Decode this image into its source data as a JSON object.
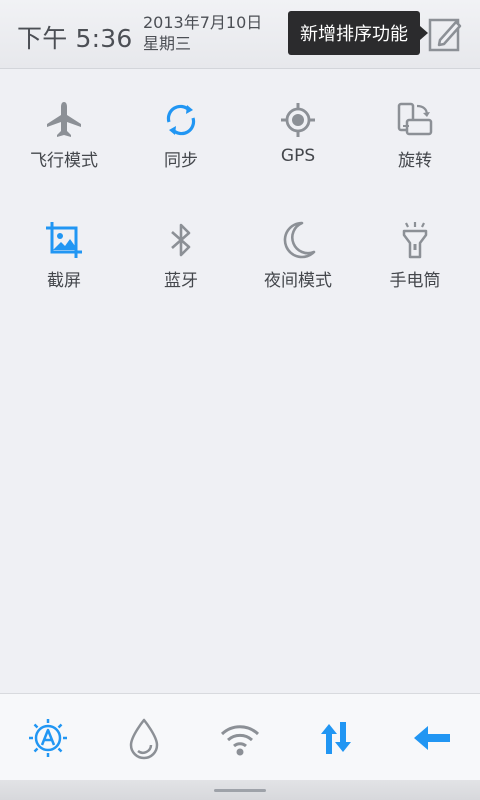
{
  "status": {
    "time": "下午 5:36",
    "date": "2013年7月10日",
    "weekday": "星期三"
  },
  "tooltip": {
    "text": "新增排序功能"
  },
  "toggles": [
    {
      "label": "飞行模式",
      "icon": "airplane-icon",
      "color": "#8c9096"
    },
    {
      "label": "同步",
      "icon": "sync-icon",
      "color": "#2196f3"
    },
    {
      "label": "GPS",
      "icon": "gps-icon",
      "color": "#8c9096"
    },
    {
      "label": "旋转",
      "icon": "rotate-icon",
      "color": "#8c9096"
    },
    {
      "label": "截屏",
      "icon": "screenshot-icon",
      "color": "#2196f3"
    },
    {
      "label": "蓝牙",
      "icon": "bluetooth-icon",
      "color": "#8c9096"
    },
    {
      "label": "夜间模式",
      "icon": "night-mode-icon",
      "color": "#8c9096"
    },
    {
      "label": "手电筒",
      "icon": "flashlight-icon",
      "color": "#8c9096"
    }
  ],
  "bottom_bar": [
    {
      "icon": "auto-brightness-icon",
      "color": "#2196f3"
    },
    {
      "icon": "data-drop-icon",
      "color": "#8c9096"
    },
    {
      "icon": "wifi-icon",
      "color": "#8c9096"
    },
    {
      "icon": "mobile-data-icon",
      "color": "#2196f3"
    },
    {
      "icon": "back-arrow-icon",
      "color": "#2196f3"
    }
  ]
}
